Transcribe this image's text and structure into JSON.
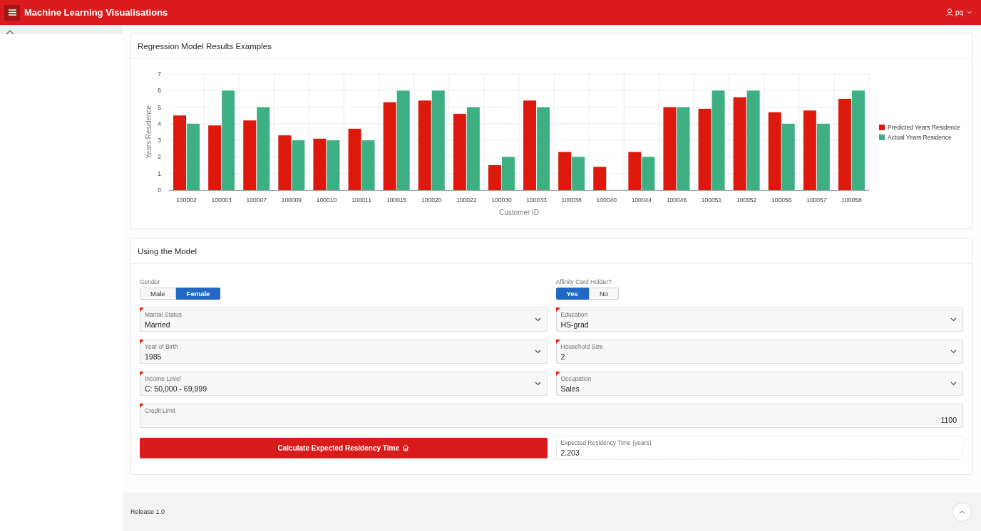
{
  "header": {
    "title": "Machine Learning Visualisations",
    "user": "pq"
  },
  "chart_card": {
    "title": "Regression Model Results Examples",
    "chart_data": {
      "type": "bar",
      "xlabel": "Customer ID",
      "ylabel": "Years Residence",
      "categories": [
        "100002",
        "100003",
        "100007",
        "100009",
        "100010",
        "100011",
        "100015",
        "100020",
        "100022",
        "100030",
        "100033",
        "100038",
        "100040",
        "100044",
        "100046",
        "100051",
        "100052",
        "100056",
        "100057",
        "100058"
      ],
      "series": [
        {
          "name": "Predicted Years Residence",
          "color": "#dc190b",
          "values": [
            4.5,
            3.9,
            4.2,
            3.3,
            3.1,
            3.7,
            5.3,
            5.4,
            4.6,
            1.5,
            5.4,
            2.3,
            1.4,
            2.3,
            5,
            4.9,
            5.6,
            4.7,
            4.8,
            5.5
          ]
        },
        {
          "name": "Actual Years Residence",
          "color": "#3daf83",
          "values": [
            4,
            6,
            5,
            3,
            3,
            3,
            6,
            6,
            5,
            2,
            5,
            2,
            null,
            2,
            5,
            6,
            6,
            4,
            4,
            6
          ]
        }
      ],
      "ylim": [
        0,
        7
      ],
      "yticks": [
        {
          "value": 0,
          "label": "0"
        },
        {
          "value": 1,
          "label": "1"
        },
        {
          "value": 2,
          "label": "2"
        },
        {
          "value": 3,
          "label": "3"
        },
        {
          "value": 4,
          "label": "4"
        },
        {
          "value": 5,
          "label": "5"
        },
        {
          "value": 6,
          "label": "6"
        },
        {
          "value": 7,
          "label": "7"
        }
      ],
      "grid": true,
      "legend": true
    }
  },
  "model_card": {
    "title": "Using the Model",
    "fields": [
      {
        "kind": "toggle",
        "label": "Gender",
        "options": [
          {
            "label": "Male",
            "selected": false
          },
          {
            "label": "Female",
            "selected": true
          }
        ]
      },
      {
        "kind": "toggle",
        "label": "Affinity Card Holder?",
        "options": [
          {
            "label": "Yes",
            "selected": true
          },
          {
            "label": "No",
            "selected": false
          }
        ]
      },
      {
        "kind": "select",
        "label": "Marital Status",
        "value": "Married",
        "required": true
      },
      {
        "kind": "select",
        "label": "Education",
        "value": "HS-grad",
        "required": true
      },
      {
        "kind": "select",
        "label": "Year of Birth",
        "value": "1985",
        "required": true
      },
      {
        "kind": "select",
        "label": "Household Size",
        "value": "2",
        "required": true
      },
      {
        "kind": "select",
        "label": "Income Level",
        "value": "C: 50,000 - 69,999",
        "required": true
      },
      {
        "kind": "select",
        "label": "Occupation",
        "value": "Sales",
        "required": true
      },
      {
        "kind": "number",
        "label": "Credit Limit",
        "value": "1100",
        "required": true
      }
    ],
    "button": {
      "label": "Calculate Expected Residency Time"
    },
    "result": {
      "label": "Expected Residency Time (years)",
      "value": "2.203"
    }
  },
  "footer": {
    "release": "Release 1.0"
  }
}
